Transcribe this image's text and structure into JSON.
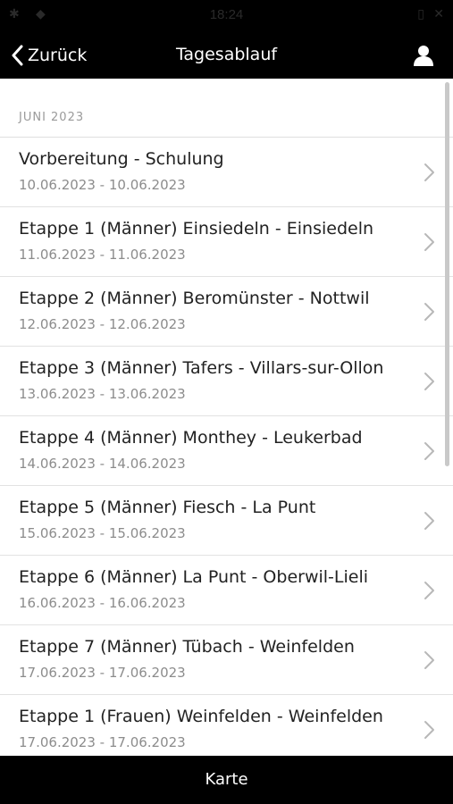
{
  "status_bar": {
    "time": "18:24"
  },
  "nav": {
    "back_label": "Zurück",
    "title": "Tagesablauf"
  },
  "section": {
    "header": "JUNI 2023"
  },
  "items": [
    {
      "title": "Vorbereitung - Schulung",
      "dates": "10.06.2023 - 10.06.2023"
    },
    {
      "title": "Etappe 1 (Männer) Einsiedeln - Einsiedeln",
      "dates": "11.06.2023 - 11.06.2023"
    },
    {
      "title": "Etappe 2 (Männer) Beromünster - Nottwil",
      "dates": "12.06.2023 - 12.06.2023"
    },
    {
      "title": "Etappe 3 (Männer) Tafers - Villars-sur-Ollon",
      "dates": "13.06.2023 - 13.06.2023"
    },
    {
      "title": "Etappe 4 (Männer) Monthey - Leukerbad",
      "dates": "14.06.2023 - 14.06.2023"
    },
    {
      "title": "Etappe 5 (Männer) Fiesch - La Punt",
      "dates": "15.06.2023 - 15.06.2023"
    },
    {
      "title": "Etappe 6 (Männer) La Punt - Oberwil-Lieli",
      "dates": "16.06.2023 - 16.06.2023"
    },
    {
      "title": "Etappe 7 (Männer) Tübach - Weinfelden",
      "dates": "17.06.2023 - 17.06.2023"
    },
    {
      "title": "Etappe 1 (Frauen) Weinfelden - Weinfelden",
      "dates": "17.06.2023 - 17.06.2023"
    }
  ],
  "bottom_bar": {
    "label": "Karte"
  },
  "colors": {
    "bar_background": "#000000",
    "text_primary": "#222222",
    "text_secondary": "#8c8c8c"
  },
  "icons": {
    "back": "chevron-left-icon",
    "profile": "user-icon",
    "row": "chevron-right-icon"
  }
}
